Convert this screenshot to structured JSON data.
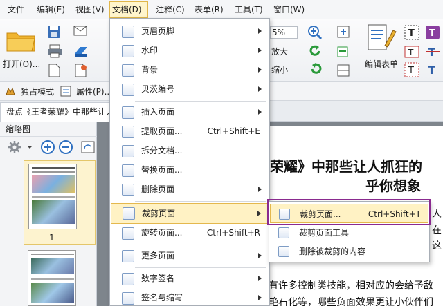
{
  "menubar": {
    "items": [
      "文件",
      "编辑(E)",
      "视图(V)",
      "文档(D)",
      "注释(C)",
      "表单(R)",
      "工具(T)",
      "窗口(W)"
    ]
  },
  "ribbon": {
    "open_label": "打开(O)...",
    "zoom_value": "5%",
    "zoom_in_label": "放大",
    "zoom_out_label": "缩小",
    "edit_form_label": "编辑表单"
  },
  "quickbar": {
    "exclusive_mode": "独占模式",
    "properties": "属性(P)..."
  },
  "doc_tab": {
    "title": "盘点《王者荣耀》中那些让人"
  },
  "thumbnails": {
    "title": "缩略图",
    "page1_number": "1"
  },
  "page": {
    "heading_line1": "荣耀》中那些让人抓狂的",
    "heading_line2": "乎你想象",
    "side_char1": "人",
    "side_char2": "在",
    "side_char3": "这",
    "bottom_line1": "有许多控制类技能，相对应的会给予敌",
    "bottom_line2": "艳石化等，哪些负面效果更让小伙伴们"
  },
  "doc_menu": {
    "items": [
      {
        "label": "页眉页脚",
        "shortcut": "",
        "submenu": true
      },
      {
        "label": "水印",
        "shortcut": "",
        "submenu": true
      },
      {
        "label": "背景",
        "shortcut": "",
        "submenu": true
      },
      {
        "label": "贝茨编号",
        "shortcut": "",
        "submenu": true
      },
      {
        "label": "插入页面",
        "shortcut": "",
        "submenu": true
      },
      {
        "label": "提取页面...",
        "shortcut": "Ctrl+Shift+E",
        "submenu": false
      },
      {
        "label": "拆分文档...",
        "shortcut": "",
        "submenu": false
      },
      {
        "label": "替换页面...",
        "shortcut": "",
        "submenu": false
      },
      {
        "label": "删除页面",
        "shortcut": "",
        "submenu": true
      },
      {
        "label": "裁剪页面",
        "shortcut": "",
        "submenu": true
      },
      {
        "label": "旋转页面...",
        "shortcut": "Ctrl+Shift+R",
        "submenu": false
      },
      {
        "label": "更多页面",
        "shortcut": "",
        "submenu": true
      },
      {
        "label": "数字签名",
        "shortcut": "",
        "submenu": true
      },
      {
        "label": "签名与缩写",
        "shortcut": "",
        "submenu": true
      }
    ]
  },
  "crop_submenu": {
    "items": [
      {
        "label": "裁剪页面...",
        "shortcut": "Ctrl+Shift+T"
      },
      {
        "label": "裁剪页面工具",
        "shortcut": ""
      },
      {
        "label": "删除被裁剪的内容",
        "shortcut": ""
      }
    ]
  },
  "colors": {
    "highlight": "#fff2c4",
    "highlight_border": "#e4b84d",
    "callout": "#8a2a8f",
    "heading": "#111111"
  }
}
